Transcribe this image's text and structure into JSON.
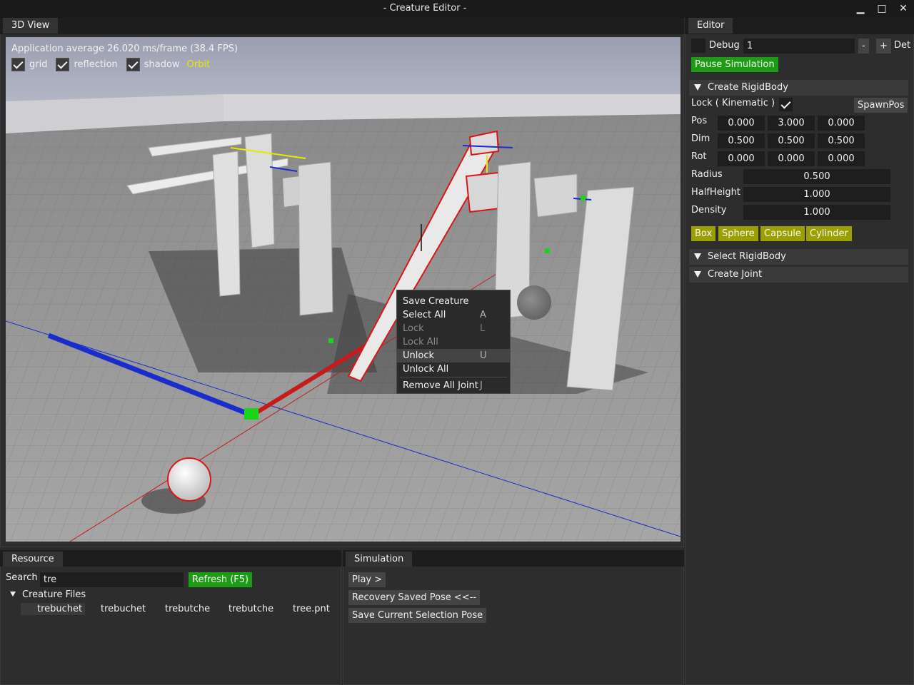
{
  "window": {
    "title": "- Creature Editor -",
    "minimize": "▁",
    "maximize": "□",
    "close": "✕"
  },
  "view3d": {
    "tab": "3D View",
    "fps_text": "Application average 26.020 ms/frame (38.4 FPS)",
    "options": [
      {
        "label": "grid",
        "checked": true
      },
      {
        "label": "reflection",
        "checked": true
      },
      {
        "label": "shadow",
        "checked": true
      }
    ],
    "mode_label": "Orbit",
    "mode_color": "#e8e800"
  },
  "context_menu": {
    "items": [
      {
        "label": "Save Creature",
        "shortcut": "",
        "enabled": true
      },
      {
        "label": "Select All",
        "shortcut": "A",
        "enabled": true
      },
      {
        "label": "Lock",
        "shortcut": "L",
        "enabled": false
      },
      {
        "label": "Lock All",
        "shortcut": "",
        "enabled": false
      },
      {
        "label": "Unlock",
        "shortcut": "U",
        "enabled": true,
        "hovered": true
      },
      {
        "label": "Unlock All",
        "shortcut": "",
        "enabled": true
      },
      {
        "label": "Remove All Joint",
        "shortcut": "J",
        "enabled": true
      }
    ]
  },
  "editor": {
    "tab": "Editor",
    "debug_label": "Debug",
    "debug_value": "1",
    "minus": "-",
    "plus": "+",
    "det_label": "Det",
    "pause_button": "Pause Simulation",
    "create_rigidbody": {
      "header": "Create RigidBody",
      "lock_label": "Lock ( Kinematic )",
      "lock_checked": true,
      "spawnpos_button": "SpawnPos",
      "pos_label": "Pos",
      "pos": [
        "0.000",
        "3.000",
        "0.000"
      ],
      "dim_label": "Dim",
      "dim": [
        "0.500",
        "0.500",
        "0.500"
      ],
      "rot_label": "Rot",
      "rot": [
        "0.000",
        "0.000",
        "0.000"
      ],
      "radius_label": "Radius",
      "radius": "0.500",
      "halfheight_label": "HalfHeight",
      "halfheight": "1.000",
      "density_label": "Density",
      "density": "1.000",
      "shape_buttons": [
        "Box",
        "Sphere",
        "Capsule",
        "Cylinder"
      ]
    },
    "select_rigidbody_header": "Select RigidBody",
    "create_joint_header": "Create Joint"
  },
  "resource": {
    "tab": "Resource",
    "search_label": "Search",
    "search_value": "tre",
    "refresh_button": "Refresh (F5)",
    "tree_header": "Creature Files",
    "files": [
      "trebuchet",
      "trebuchet",
      "trebutche",
      "trebutche",
      "tree.pnt"
    ]
  },
  "simulation": {
    "tab": "Simulation",
    "play_button": "Play >",
    "recovery_button": "Recovery Saved Pose <<--",
    "save_pose_button": "Save Current Selection Pose"
  },
  "colors": {
    "accent_green": "#1e9b14",
    "accent_yellow": "#9aa000",
    "axis_red": "#c81a1a",
    "axis_blue": "#1a2ccc",
    "selection_outline": "#d81818"
  }
}
